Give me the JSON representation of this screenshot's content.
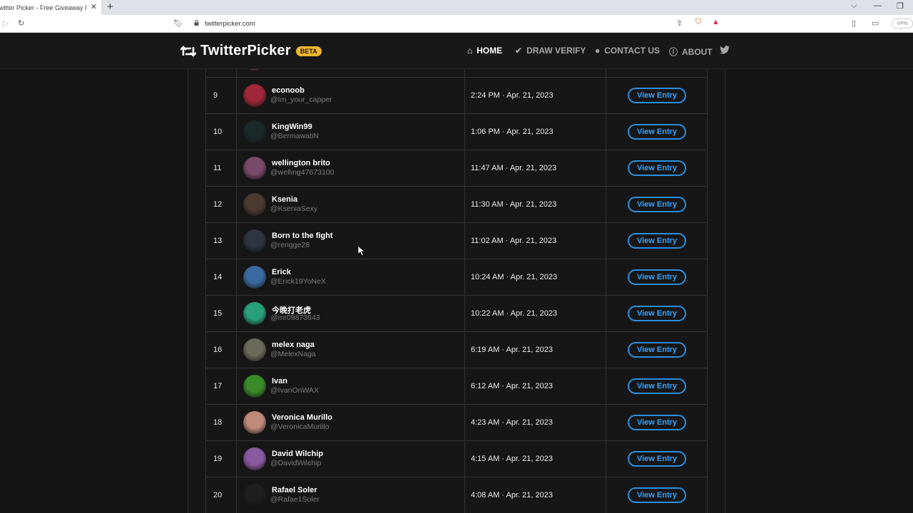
{
  "browser": {
    "tab_title": "witter Picker - Free Giveaway Pic",
    "url": "twitterpicker.com",
    "vpn_label": "VPN"
  },
  "site": {
    "brand": "TwitterPicker",
    "beta": "BETA",
    "nav": {
      "home": "HOME",
      "draw_verify": "DRAW VERIFY",
      "contact": "CONTACT US",
      "about": "ABOUT"
    }
  },
  "entries": [
    {
      "num": "",
      "name": "",
      "handle": "",
      "time": "",
      "action": "",
      "avatar": "#a04050"
    },
    {
      "num": "9",
      "name": "econoob",
      "handle": "@Im_your_capper",
      "time": "2:24 PM · Apr. 21, 2023",
      "action": "View Entry",
      "avatar": "#a0283a"
    },
    {
      "num": "10",
      "name": "KingWin99",
      "handle": "@BermawatiN",
      "time": "1:06 PM · Apr. 21, 2023",
      "action": "View Entry",
      "avatar": "#1a2a2a"
    },
    {
      "num": "11",
      "name": "wellington brito",
      "handle": "@welling47673100",
      "time": "11:47 AM · Apr. 21, 2023",
      "action": "View Entry",
      "avatar": "#7a4a6a"
    },
    {
      "num": "12",
      "name": "Ksenia",
      "handle": "@KseniaSexy",
      "time": "11:30 AM · Apr. 21, 2023",
      "action": "View Entry",
      "avatar": "#4a3a30"
    },
    {
      "num": "13",
      "name": "Born to the fight",
      "handle": "@rengge28",
      "time": "11:02 AM · Apr. 21, 2023",
      "action": "View Entry",
      "avatar": "#2e3540"
    },
    {
      "num": "14",
      "name": "Erick",
      "handle": "@Erick19YoNeX",
      "time": "10:24 AM · Apr. 21, 2023",
      "action": "View Entry",
      "avatar": "#3a6aa0"
    },
    {
      "num": "15",
      "name": "今晚打老虎",
      "handle": "@mr09873643",
      "time": "10:22 AM · Apr. 21, 2023",
      "action": "View Entry",
      "avatar": "#2aa07a"
    },
    {
      "num": "16",
      "name": "melex naga",
      "handle": "@MelexNaga",
      "time": "6:19 AM · Apr. 21, 2023",
      "action": "View Entry",
      "avatar": "#6a6a5a"
    },
    {
      "num": "17",
      "name": "Ivan",
      "handle": "@IvanOnWAX",
      "time": "6:12 AM · Apr. 21, 2023",
      "action": "View Entry",
      "avatar": "#3a8a2a"
    },
    {
      "num": "18",
      "name": "Veronica Murillo",
      "handle": "@VeronicaMurillo",
      "time": "4:23 AM · Apr. 21, 2023",
      "action": "View Entry",
      "avatar": "#c08a7a"
    },
    {
      "num": "19",
      "name": "David Wilchip",
      "handle": "@DavidWilchip",
      "time": "4:15 AM · Apr. 21, 2023",
      "action": "View Entry",
      "avatar": "#8a5aa0"
    },
    {
      "num": "20",
      "name": "Rafael Soler",
      "handle": "@Rafae1Soler",
      "time": "4:08 AM · Apr. 21, 2023",
      "action": "View Entry",
      "avatar": "#1e1e1e"
    }
  ],
  "colors": {
    "accent": "#2b8fe0",
    "beta_badge": "#f0b72f",
    "background": "#141414"
  }
}
